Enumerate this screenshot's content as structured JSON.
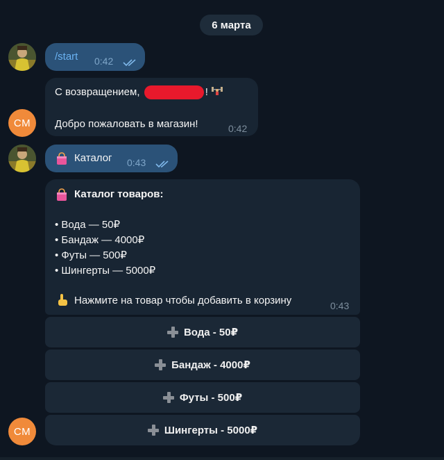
{
  "chat": {
    "date_label": "6 марта",
    "messages": [
      {
        "sender": "user",
        "text": "/start",
        "time": "0:42",
        "status": "read"
      },
      {
        "sender": "bot",
        "line1_prefix": "С возвращением, ",
        "line1_suffix": "! ",
        "line2": "Добро пожаловать в магазин!",
        "time": "0:42"
      },
      {
        "sender": "user",
        "text": "Каталог",
        "time": "0:43",
        "status": "read"
      },
      {
        "sender": "bot",
        "title": "Каталог товаров:",
        "items": [
          "• Вода — 50₽",
          "• Бандаж — 4000₽",
          "• Футы — 500₽",
          "• Шингерты — 5000₽"
        ],
        "hint": "Нажмите на товар чтобы добавить в корзину",
        "time": "0:43"
      }
    ],
    "bot_avatar_initials": "CM",
    "keyboard": [
      {
        "label": "Вода - 50₽"
      },
      {
        "label": "Бандаж - 4000₽"
      },
      {
        "label": "Футы - 500₽"
      },
      {
        "label": "Шингерты - 5000₽"
      }
    ]
  },
  "colors": {
    "background": "#0e1621",
    "outgoing_bubble": "#2b5278",
    "incoming_bubble": "#182533",
    "link": "#6ab2f2",
    "avatar_bot": "#f08a3a",
    "redaction": "#e8192c"
  },
  "icons": {
    "tick": "double-check-icon",
    "bag": "shopping-bag-emoji",
    "pointer": "pointing-finger-emoji",
    "weight": "weightlifter-emoji",
    "plus": "plus-icon"
  }
}
